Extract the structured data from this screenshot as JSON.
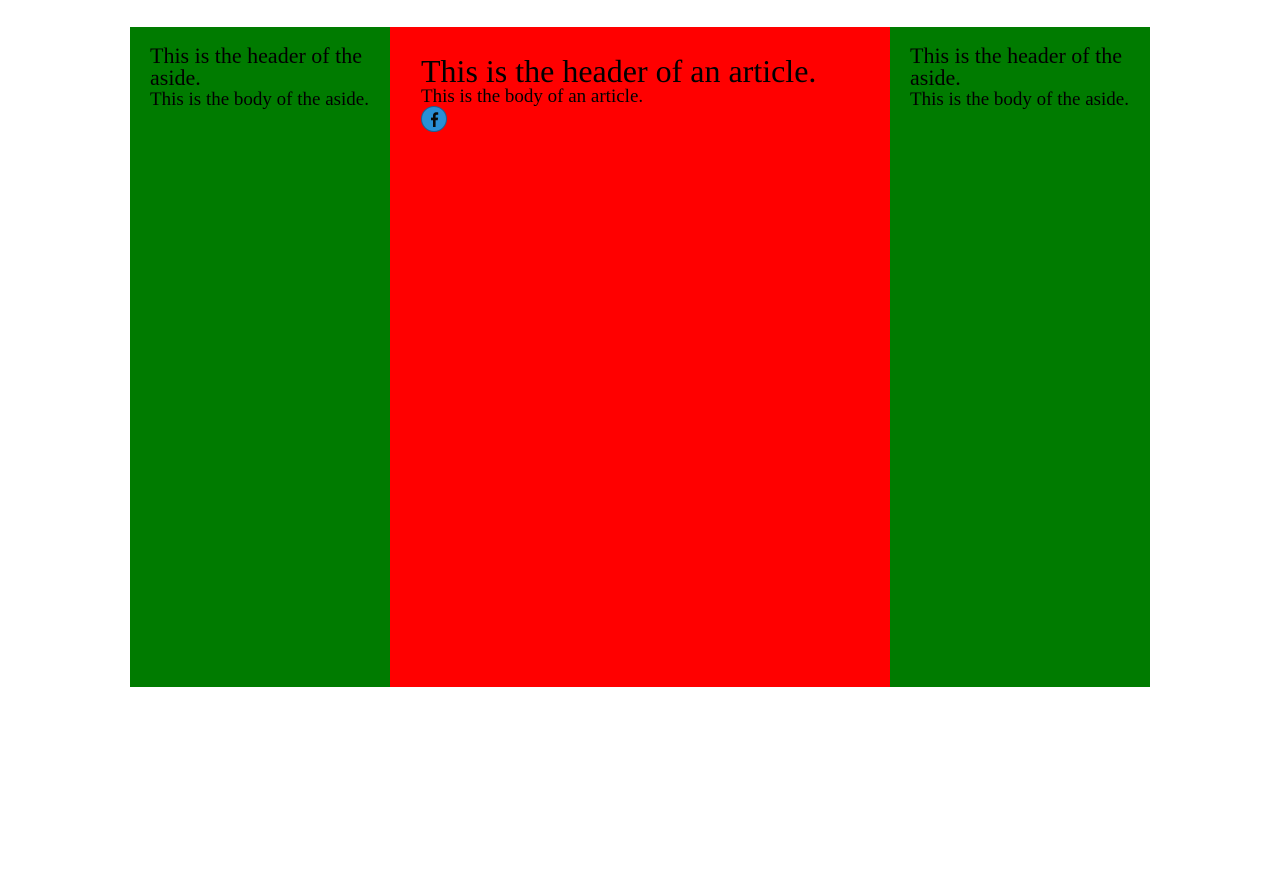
{
  "left_aside": {
    "header": "This is the header of the aside.",
    "body": "This is the body of the aside."
  },
  "article": {
    "header": "This is the header of an article.",
    "body": "This is the body of an article.",
    "share_icon": "facebook-icon"
  },
  "right_aside": {
    "header": "This is the header of the aside.",
    "body": "This is the body of the aside."
  },
  "colors": {
    "aside_background": "#007b00",
    "article_background": "#ff0000",
    "facebook_button": "#2a8fd6",
    "page_background": "#ffffff"
  }
}
